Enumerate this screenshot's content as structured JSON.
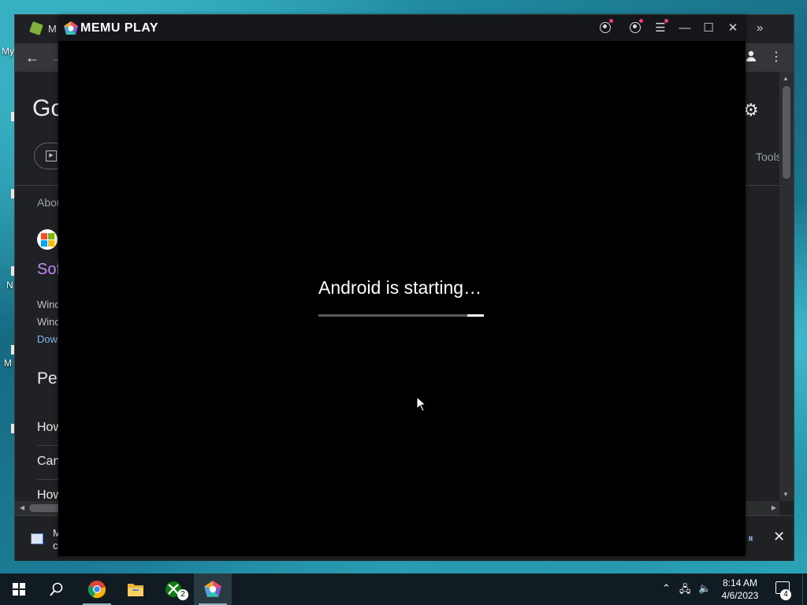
{
  "desktop": {
    "labels": [
      "My",
      "N",
      "M"
    ]
  },
  "chrome": {
    "tab_title": "M",
    "search": {
      "logo_text": "Go",
      "tools_label": "Tools",
      "about_text": "Abou",
      "result_title": "Sof",
      "result_line_1": "Wind",
      "result_line_2": "Wind",
      "result_link": "Dow",
      "people_heading": "Pe",
      "questions": [
        "How",
        "Can",
        "How"
      ]
    },
    "download": {
      "line_1": "M",
      "line_2": "c"
    }
  },
  "memu": {
    "title": "MEMU PLAY",
    "boot_message": "Android is starting…",
    "boot_progress": 0.1,
    "accent": "#ffffff"
  },
  "taskbar": {
    "apps": [
      {
        "name": "chrome",
        "icon": "chrome-icon"
      },
      {
        "name": "file-explorer",
        "icon": "folder-icon"
      },
      {
        "name": "xbox",
        "icon": "xbox-icon",
        "badge": "2"
      },
      {
        "name": "memu",
        "icon": "memu-icon"
      }
    ],
    "clock_time": "8:14 AM",
    "clock_date": "4/6/2023",
    "notification_count": "4"
  }
}
